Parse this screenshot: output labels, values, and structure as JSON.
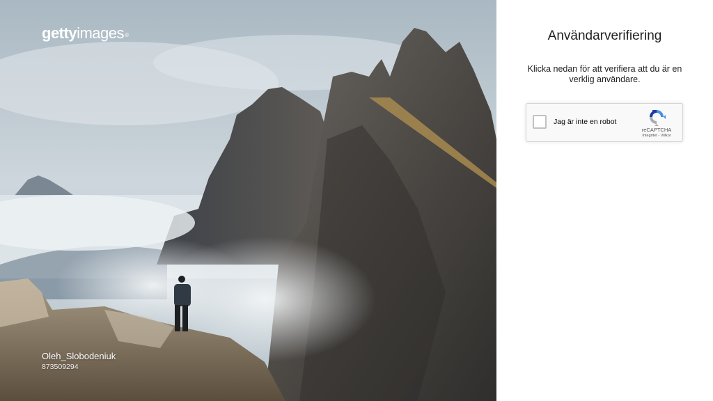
{
  "logo": {
    "part1": "getty",
    "part2": "images",
    "mark": "®"
  },
  "photo_credit": {
    "name": "Oleh_Slobodeniuk",
    "id": "873509294"
  },
  "verification": {
    "title": "Användarverifiering",
    "description": "Klicka nedan för att verifiera att du är en verklig användare."
  },
  "captcha": {
    "checkbox_label": "Jag är inte en robot",
    "brand": "reCAPTCHA",
    "privacy_link": "Integritet",
    "separator": " - ",
    "terms_link": "Villkor",
    "icon": "recaptcha-icon"
  },
  "colors": {
    "panel_background": "#ffffff",
    "captcha_background": "#f9f9f9",
    "captcha_border": "#d3d3d3",
    "recaptcha_blue": "#4a90e2",
    "recaptcha_dark_blue": "#1c3aa9",
    "recaptcha_gray": "#ababab"
  }
}
